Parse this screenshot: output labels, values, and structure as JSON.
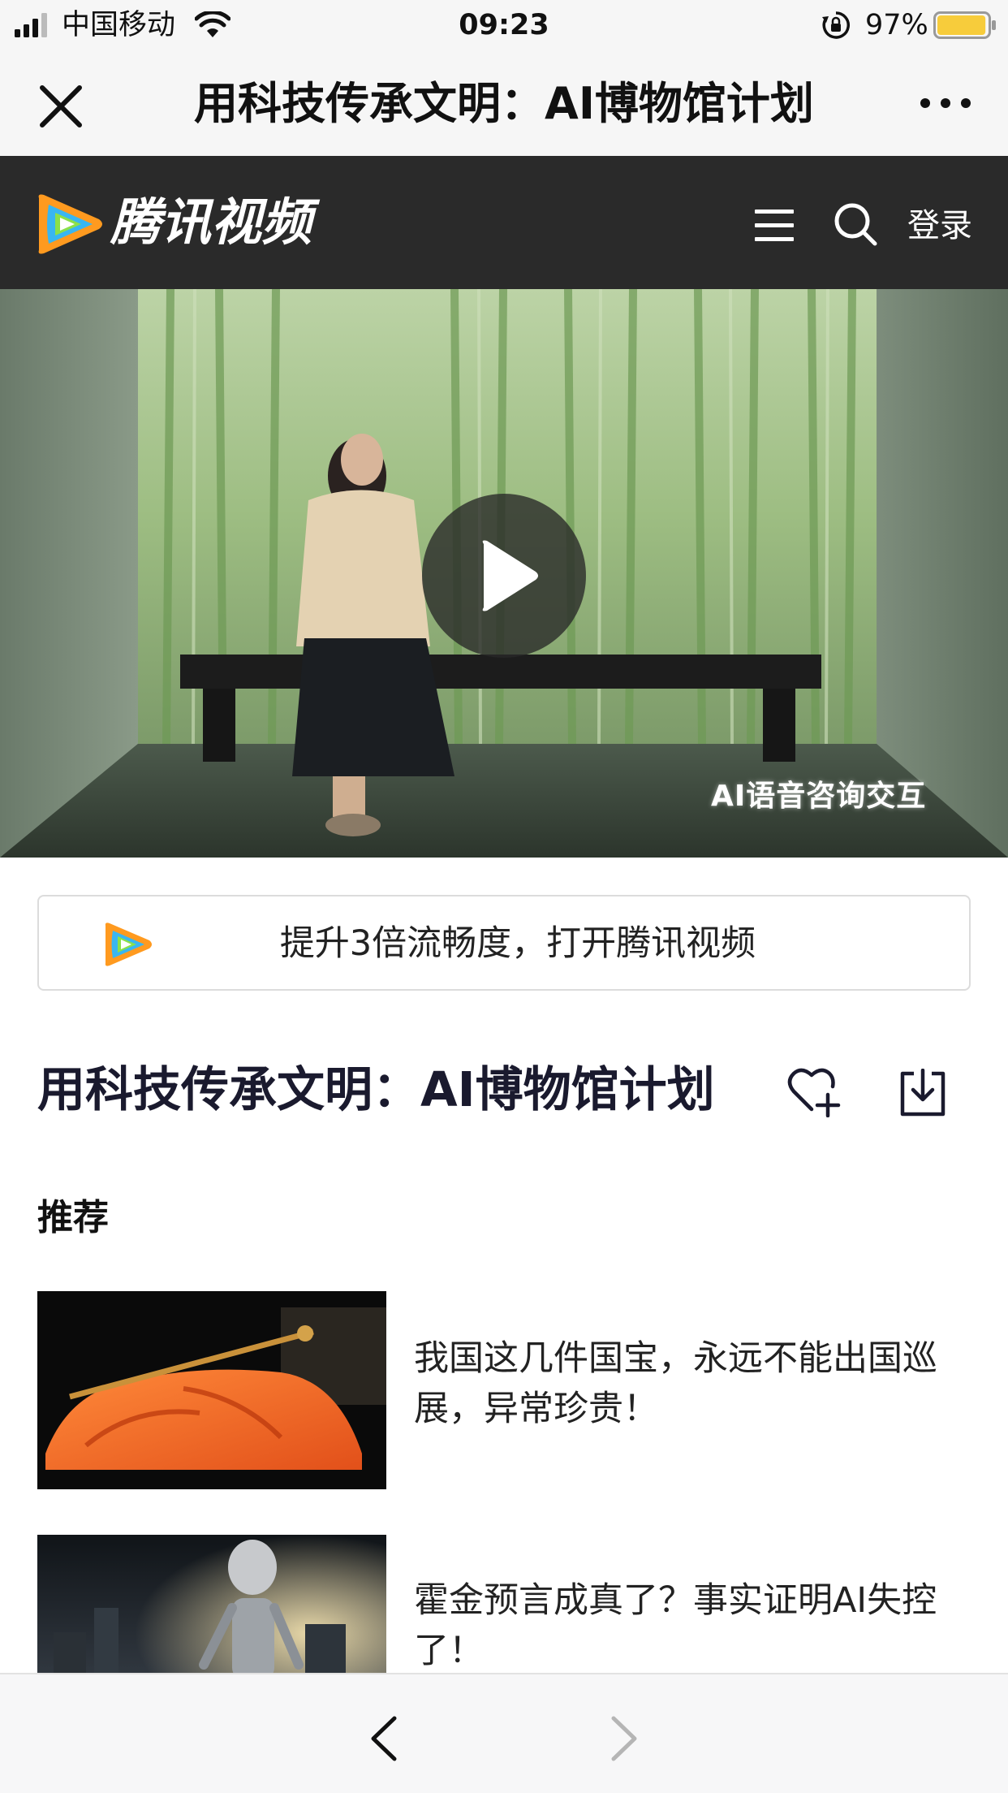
{
  "status_bar": {
    "carrier": "中国移动",
    "time": "09:23",
    "battery": "97%",
    "battery_level": 0.97,
    "battery_color": "#f7cc3b"
  },
  "nav": {
    "title": "用科技传承文明：AI博物馆计划",
    "close_icon": "close-icon",
    "more_icon": "more-dots-icon"
  },
  "tv_header": {
    "brand": "腾讯视频",
    "login": "登录",
    "menu_icon": "hamburger-menu-icon",
    "search_icon": "search-icon"
  },
  "video": {
    "caption": "AI语音咨询交互",
    "play_icon": "play-icon"
  },
  "open_app_banner": {
    "text": "提升3倍流畅度，打开腾讯视频"
  },
  "title_row": {
    "title": "用科技传承文明：AI博物馆计划",
    "favorite_icon": "heart-plus-icon",
    "download_icon": "download-icon"
  },
  "recommendations": {
    "heading": "推荐",
    "items": [
      {
        "title": "我国这几件国宝，永远不能出国巡展，异常珍贵！"
      },
      {
        "title": "霍金预言成真了？事实证明AI失控了！"
      }
    ]
  },
  "bottom_bar": {
    "back_icon": "chevron-left-icon",
    "forward_icon": "chevron-right-icon"
  },
  "colors": {
    "tv_header_bg": "#2a2a2a",
    "title_color": "#1a1a2e",
    "nav_bg": "#f6f6f6"
  }
}
